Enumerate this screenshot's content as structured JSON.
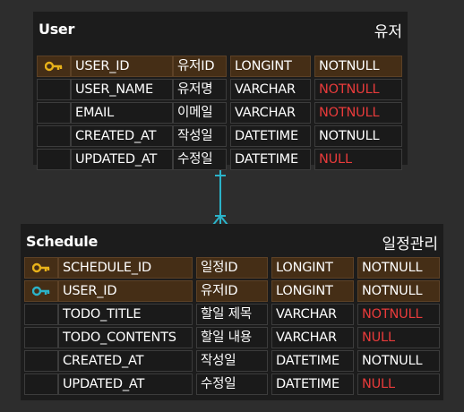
{
  "entities": [
    {
      "name": "User",
      "alias": "유저",
      "rows": [
        {
          "key": "pk",
          "key_icon": "gold-key-icon",
          "column": "USER_ID",
          "logical": "유저ID",
          "type": "LONGINT",
          "nullability": "NOTNULL",
          "nullability_color": "#ffffff"
        },
        {
          "key": "",
          "key_icon": "",
          "column": "USER_NAME",
          "logical": "유저명",
          "type": "VARCHAR",
          "nullability": "NOTNULL",
          "nullability_color": "#e83b3b"
        },
        {
          "key": "",
          "key_icon": "",
          "column": "EMAIL",
          "logical": "이메일",
          "type": "VARCHAR",
          "nullability": "NOTNULL",
          "nullability_color": "#e83b3b"
        },
        {
          "key": "",
          "key_icon": "",
          "column": "CREATED_AT",
          "logical": "작성일",
          "type": "DATETIME",
          "nullability": "NOTNULL",
          "nullability_color": "#ffffff"
        },
        {
          "key": "",
          "key_icon": "",
          "column": "UPDATED_AT",
          "logical": "수정일",
          "type": "DATETIME",
          "nullability": "NULL",
          "nullability_color": "#e83b3b"
        }
      ]
    },
    {
      "name": "Schedule",
      "alias": "일정관리",
      "rows": [
        {
          "key": "pk",
          "key_icon": "gold-key-icon",
          "column": "SCHEDULE_ID",
          "logical": "일정ID",
          "type": "LONGINT",
          "nullability": "NOTNULL",
          "nullability_color": "#ffffff"
        },
        {
          "key": "fk",
          "key_icon": "teal-key-icon",
          "column": "USER_ID",
          "logical": "유저ID",
          "type": "LONGINT",
          "nullability": "NOTNULL",
          "nullability_color": "#ffffff"
        },
        {
          "key": "",
          "key_icon": "",
          "column": "TODO_TITLE",
          "logical": "할일 제목",
          "type": "VARCHAR",
          "nullability": "NOTNULL",
          "nullability_color": "#e83b3b"
        },
        {
          "key": "",
          "key_icon": "",
          "column": "TODO_CONTENTS",
          "logical": "할일 내용",
          "type": "VARCHAR",
          "nullability": "NULL",
          "nullability_color": "#e83b3b"
        },
        {
          "key": "",
          "key_icon": "",
          "column": "CREATED_AT",
          "logical": "작성일",
          "type": "DATETIME",
          "nullability": "NOTNULL",
          "nullability_color": "#ffffff"
        },
        {
          "key": "",
          "key_icon": "",
          "column": "UPDATED_AT",
          "logical": "수정일",
          "type": "DATETIME",
          "nullability": "NULL",
          "nullability_color": "#e83b3b"
        }
      ]
    }
  ],
  "relationship": {
    "from": "User",
    "to": "Schedule",
    "from_cardinality": "one",
    "to_cardinality": "many",
    "color": "#2bb3c9"
  },
  "colors": {
    "background": "#2d2d2d",
    "entity_bg": "#1c1c1c",
    "pk_row": "#452e16",
    "gold_key": "#e8b21a",
    "teal_key": "#2bb3c9",
    "red_text": "#e83b3b"
  }
}
